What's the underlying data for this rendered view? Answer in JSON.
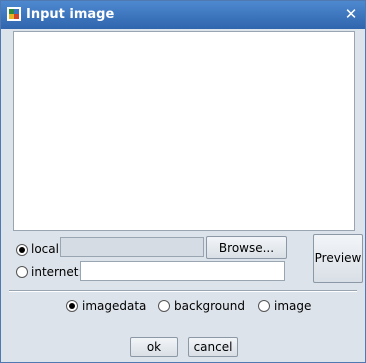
{
  "window": {
    "title": "Input image",
    "close_symbol": "✕"
  },
  "source": {
    "local": {
      "label": "local:",
      "value": "",
      "selected": true
    },
    "internet": {
      "label": "internet:",
      "value": "",
      "selected": false
    },
    "browse_label": "Browse...",
    "preview_label": "Preview"
  },
  "mode": {
    "options": [
      {
        "label": "imagedata",
        "selected": true
      },
      {
        "label": "background",
        "selected": false
      },
      {
        "label": "image",
        "selected": false
      }
    ]
  },
  "actions": {
    "ok_label": "ok",
    "cancel_label": "cancel"
  },
  "colors": {
    "titlebar": "#3a73bf",
    "background": "#dde3ea"
  }
}
